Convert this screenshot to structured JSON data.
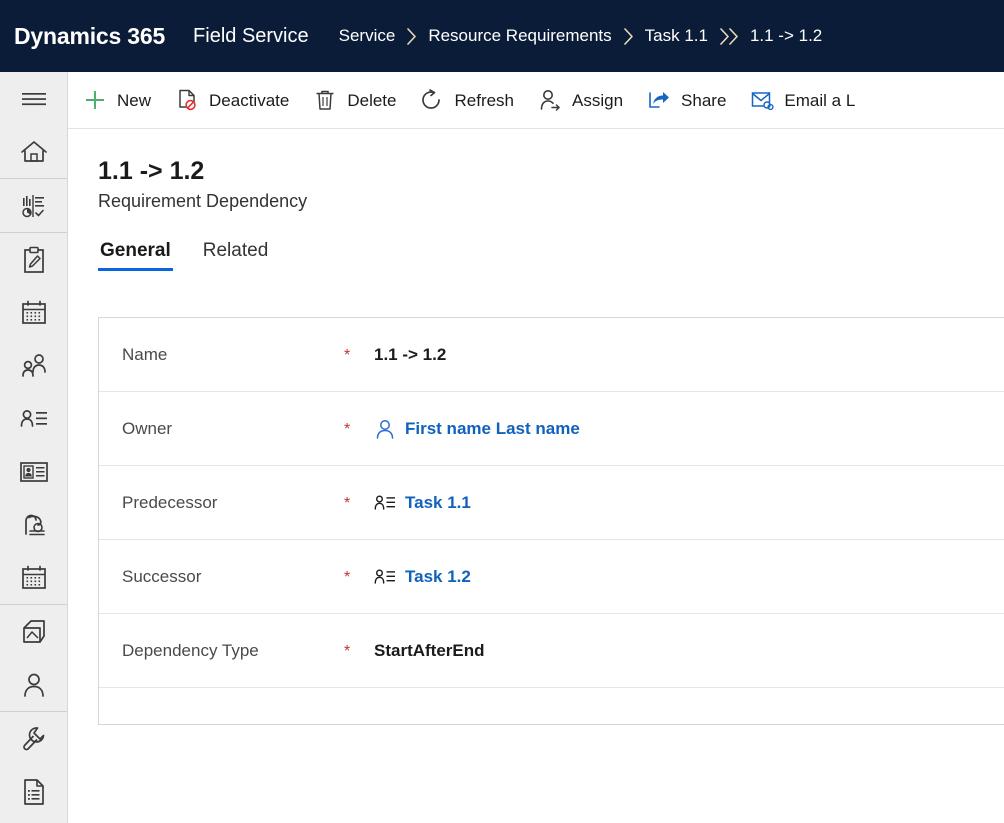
{
  "header": {
    "brand": "Dynamics 365",
    "app_name": "Field Service",
    "background_color": "#0b1c38",
    "breadcrumb": [
      {
        "label": "Service",
        "separator": "single-chevron-icon"
      },
      {
        "label": "Resource Requirements",
        "separator": "single-chevron-icon"
      },
      {
        "label": "Task 1.1",
        "separator": "double-chevron-icon"
      },
      {
        "label": "1.1 -> 1.2",
        "separator": ""
      }
    ]
  },
  "sidebar": {
    "items": [
      {
        "icon": "hamburger-menu-icon",
        "name": "site-map-toggle"
      },
      {
        "icon": "home-icon",
        "name": "home"
      },
      {
        "divider": true
      },
      {
        "icon": "dashboard-chart-icon",
        "name": "dashboards"
      },
      {
        "divider": true
      },
      {
        "icon": "clipboard-pencil-icon",
        "name": "work-orders"
      },
      {
        "icon": "calendar-icon",
        "name": "schedule-board"
      },
      {
        "icon": "people-group-icon",
        "name": "accounts"
      },
      {
        "icon": "contact-card-lines-icon",
        "name": "resource-requirements"
      },
      {
        "icon": "id-badge-icon",
        "name": "bookable-resources"
      },
      {
        "icon": "agreement-icon",
        "name": "agreements"
      },
      {
        "icon": "calendar-2-icon",
        "name": "time-off-requests"
      },
      {
        "divider": true
      },
      {
        "icon": "inventory-box-icon",
        "name": "inventory"
      },
      {
        "icon": "person-icon",
        "name": "customers"
      },
      {
        "divider": true
      },
      {
        "icon": "wrench-icon",
        "name": "service-tasks"
      },
      {
        "icon": "document-list-icon",
        "name": "reports"
      }
    ]
  },
  "command_bar": {
    "items": [
      {
        "label": "New",
        "icon": "plus-icon",
        "icon_color": "#4caf6e"
      },
      {
        "label": "Deactivate",
        "icon": "deactivate-document-icon",
        "icon_color": "#e03131"
      },
      {
        "label": "Delete",
        "icon": "trash-icon",
        "icon_color": "#3b3b3b"
      },
      {
        "label": "Refresh",
        "icon": "refresh-icon",
        "icon_color": "#3b3b3b"
      },
      {
        "label": "Assign",
        "icon": "assign-person-icon",
        "icon_color": "#3b3b3b"
      },
      {
        "label": "Share",
        "icon": "share-icon",
        "icon_color": "#1566c0"
      },
      {
        "label": "Email a L",
        "icon": "email-link-icon",
        "icon_color": "#1566c0"
      }
    ]
  },
  "record": {
    "title": "1.1 -> 1.2",
    "entity_name": "Requirement Dependency"
  },
  "tabs": [
    {
      "label": "General",
      "active": true
    },
    {
      "label": "Related",
      "active": false
    }
  ],
  "form": {
    "required_marker": "*",
    "fields": [
      {
        "label": "Name",
        "required": true,
        "value": "1.1 -> 1.2",
        "value_type": "text",
        "icon": ""
      },
      {
        "label": "Owner",
        "required": true,
        "value": "First name Last name",
        "value_type": "lookup",
        "icon": "user-outline-icon"
      },
      {
        "label": "Predecessor",
        "required": true,
        "value": "Task 1.1",
        "value_type": "lookup",
        "icon": "requirement-record-icon"
      },
      {
        "label": "Successor",
        "required": true,
        "value": "Task 1.2",
        "value_type": "lookup",
        "icon": "requirement-record-icon"
      },
      {
        "label": "Dependency Type",
        "required": true,
        "value": "StartAfterEnd",
        "value_type": "text",
        "icon": ""
      }
    ]
  },
  "colors": {
    "header_navy": "#0b1c38",
    "accent_blue": "#0a66e0",
    "link_blue": "#1161bd",
    "required_red": "#c4342b",
    "new_green": "#4caf6e",
    "sidebar_gray": "#eeeeee"
  }
}
